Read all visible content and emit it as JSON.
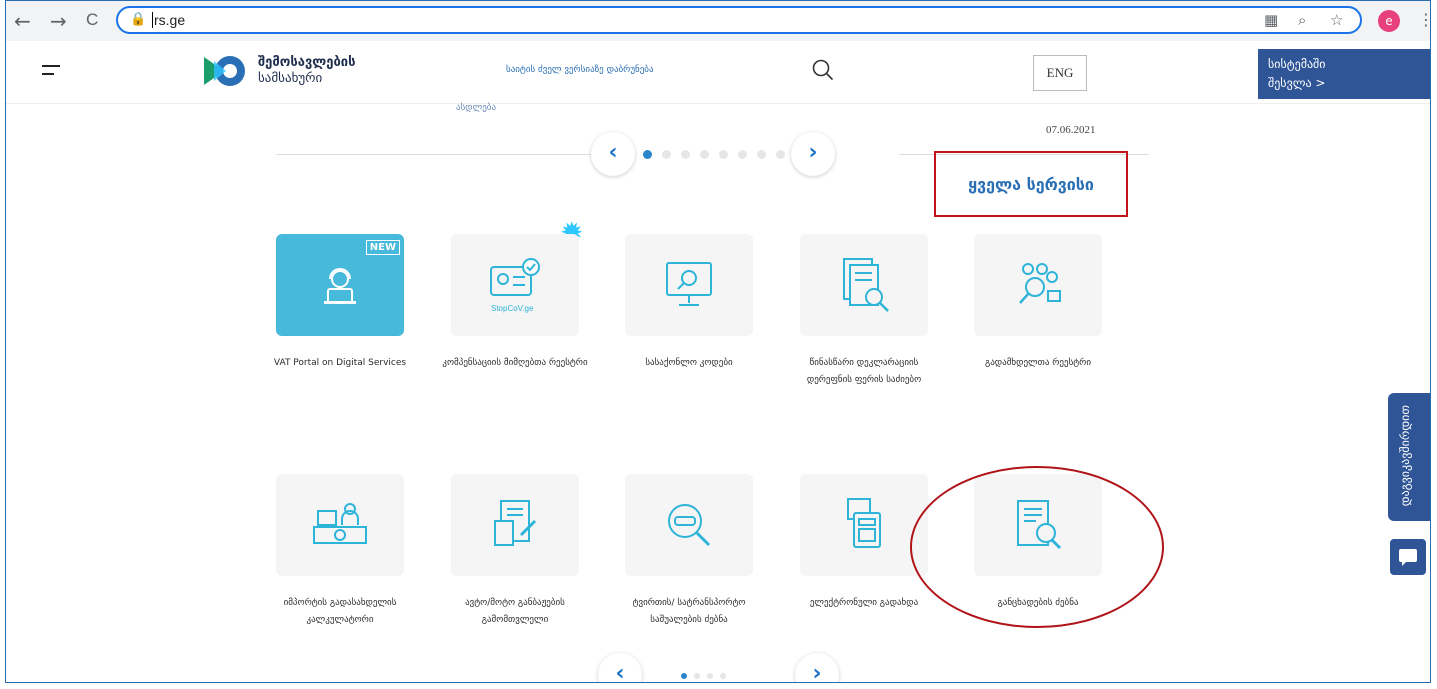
{
  "browser": {
    "back_icon": "←",
    "forward_icon": "→",
    "reload_icon": "C",
    "url": "rs.ge",
    "profile_initial": "e"
  },
  "header": {
    "logo_line1": "შემოსავლების",
    "logo_line2": "სამსახური",
    "old_version_link": "საიტის ძველ ვერსიაზე დაბრუნება",
    "lang_button": "ENG",
    "login_line1": "სისტემაში",
    "login_line2": "შესვლა >"
  },
  "carousel": {
    "partial_text": "ასდლება",
    "date": "07.06.2021",
    "prev": "‹",
    "next": "›",
    "dot_count": 8,
    "active_dot": 1
  },
  "all_services_label": "ყველა სერვისი",
  "services": [
    {
      "label": "VAT Portal on Digital Services",
      "icon": "support-agent-icon",
      "badge": "NEW",
      "featured": true
    },
    {
      "label": "კომპენსაციის მიმღებთა რეესტრი",
      "icon": "id-card-check-icon",
      "caption": "StopCoV.ge"
    },
    {
      "label": "სასაქონლო კოდები",
      "icon": "monitor-search-icon"
    },
    {
      "label": "წინასწარი დეკლარაციის დერეფნის ფერის საძიებო",
      "icon": "document-search-icon"
    },
    {
      "label": "გადამხდელთა რეესტრი",
      "icon": "people-search-icon"
    },
    {
      "label": "იმპორტის გადასახდელის კალკულატორი",
      "icon": "cashier-desk-icon"
    },
    {
      "label": "ავტო/მოტო განბაჟების გამომთვლელი",
      "icon": "calculator-document-icon"
    },
    {
      "label": "ტვირთის/ სატრანსპორტო საშუალების ძებნა",
      "icon": "vehicle-search-icon"
    },
    {
      "label": "ელექტრონული გადახდა",
      "icon": "pos-terminal-icon"
    },
    {
      "label": "განცხადების ძებნა",
      "icon": "application-search-icon"
    }
  ],
  "side_tab_label": "დაგვიკავშირდით",
  "colors": {
    "brand_blue": "#2f5597",
    "accent_blue": "#2a86cc",
    "tile_highlight": "#47b9db",
    "annotation_red": "#c0171c"
  }
}
